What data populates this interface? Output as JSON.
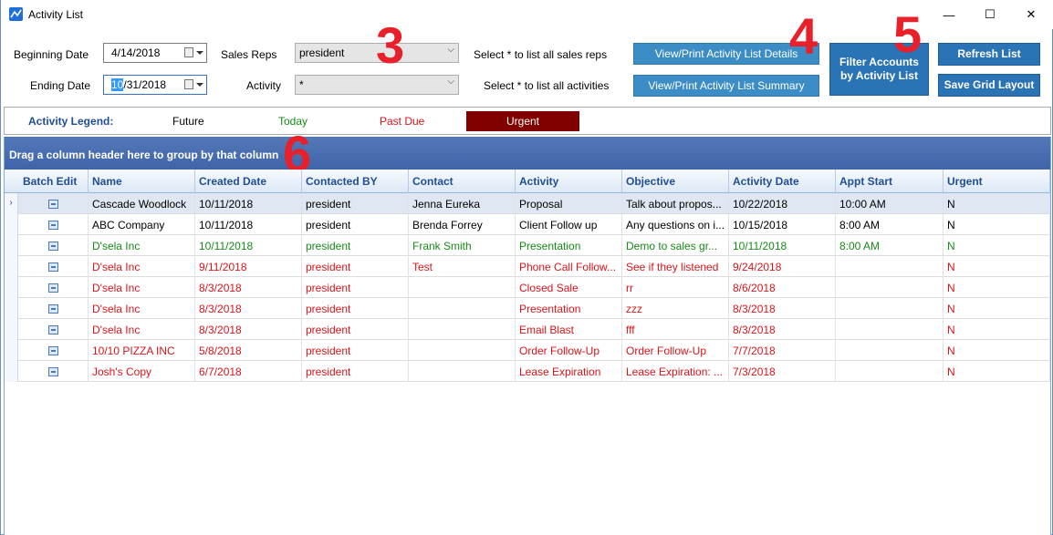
{
  "window": {
    "title": "Activity List"
  },
  "filters": {
    "beginning_date_label": "Beginning Date",
    "beginning_date": "4/14/2018",
    "ending_date_label": "Ending Date",
    "ending_date_sel": "10",
    "ending_date_rest": "/31/2018",
    "sales_reps_label": "Sales Reps",
    "sales_reps_value": "president",
    "activity_label": "Activity",
    "activity_value": "*",
    "hint_sales_reps": "Select * to list all sales reps",
    "hint_activities": "Select * to list all activities"
  },
  "buttons": {
    "view_details": "View/Print Activity List Details",
    "view_summary": "View/Print Activity List Summary",
    "filter_accounts": "Filter Accounts by Activity List",
    "refresh": "Refresh List",
    "save_grid": "Save Grid Layout"
  },
  "annotations": {
    "n3": "3",
    "n4": "4",
    "n5": "5",
    "n6": "6"
  },
  "legend": {
    "title": "Activity Legend:",
    "future": "Future",
    "today": "Today",
    "past_due": "Past Due",
    "urgent": "Urgent",
    "colors": {
      "future": "#000000",
      "today": "#178a17",
      "past_due": "#d9141a",
      "urgent_bg": "#800000"
    }
  },
  "grid": {
    "group_hint": "Drag a column header here to group by that column",
    "columns": [
      "Batch Edit",
      "Name",
      "Created Date",
      "Contacted BY",
      "Contact",
      "Activity",
      "Objective",
      "Activity Date",
      "Appt Start",
      "Urgent"
    ],
    "rows": [
      {
        "status": "black",
        "name": "Cascade Woodlock",
        "created": "10/11/2018",
        "by": "president",
        "contact": "Jenna Eureka",
        "activity": "Proposal",
        "objective": "Talk about propos...",
        "date": "10/22/2018",
        "appt": "10:00 AM",
        "urgent": "N"
      },
      {
        "status": "black",
        "name": "ABC Company",
        "created": "10/11/2018",
        "by": "president",
        "contact": "Brenda Forrey",
        "activity": "Client Follow up",
        "objective": "Any questions on i...",
        "date": "10/15/2018",
        "appt": "8:00 AM",
        "urgent": "N"
      },
      {
        "status": "green",
        "name": "D'sela Inc",
        "created": "10/11/2018",
        "by": "president",
        "contact": "Frank Smith",
        "activity": "Presentation",
        "objective": "Demo to sales gr...",
        "date": "10/11/2018",
        "appt": "8:00 AM",
        "urgent": "N"
      },
      {
        "status": "red",
        "name": "D'sela Inc",
        "created": "9/11/2018",
        "by": "president",
        "contact": "Test",
        "activity": "Phone Call Follow...",
        "objective": "See if they listened",
        "date": "9/24/2018",
        "appt": "",
        "urgent": "N"
      },
      {
        "status": "red",
        "name": "D'sela Inc",
        "created": "8/3/2018",
        "by": "president",
        "contact": "",
        "activity": "Closed Sale",
        "objective": "rr",
        "date": "8/6/2018",
        "appt": "",
        "urgent": "N"
      },
      {
        "status": "red",
        "name": "D'sela Inc",
        "created": "8/3/2018",
        "by": "president",
        "contact": "",
        "activity": "Presentation",
        "objective": " zzz",
        "date": "8/3/2018",
        "appt": "",
        "urgent": "N"
      },
      {
        "status": "red",
        "name": "D'sela Inc",
        "created": "8/3/2018",
        "by": "president",
        "contact": "",
        "activity": "Email Blast",
        "objective": "fff",
        "date": "8/3/2018",
        "appt": "",
        "urgent": "N"
      },
      {
        "status": "red",
        "name": "10/10 PIZZA INC",
        "created": "5/8/2018",
        "by": "president",
        "contact": "",
        "activity": "Order Follow-Up",
        "objective": "Order Follow-Up",
        "date": "7/7/2018",
        "appt": "",
        "urgent": "N"
      },
      {
        "status": "red",
        "name": "Josh's Copy",
        "created": "6/7/2018",
        "by": "president",
        "contact": "",
        "activity": "Lease Expiration",
        "objective": "Lease Expiration: ...",
        "date": "7/3/2018",
        "appt": "",
        "urgent": "N"
      }
    ]
  }
}
